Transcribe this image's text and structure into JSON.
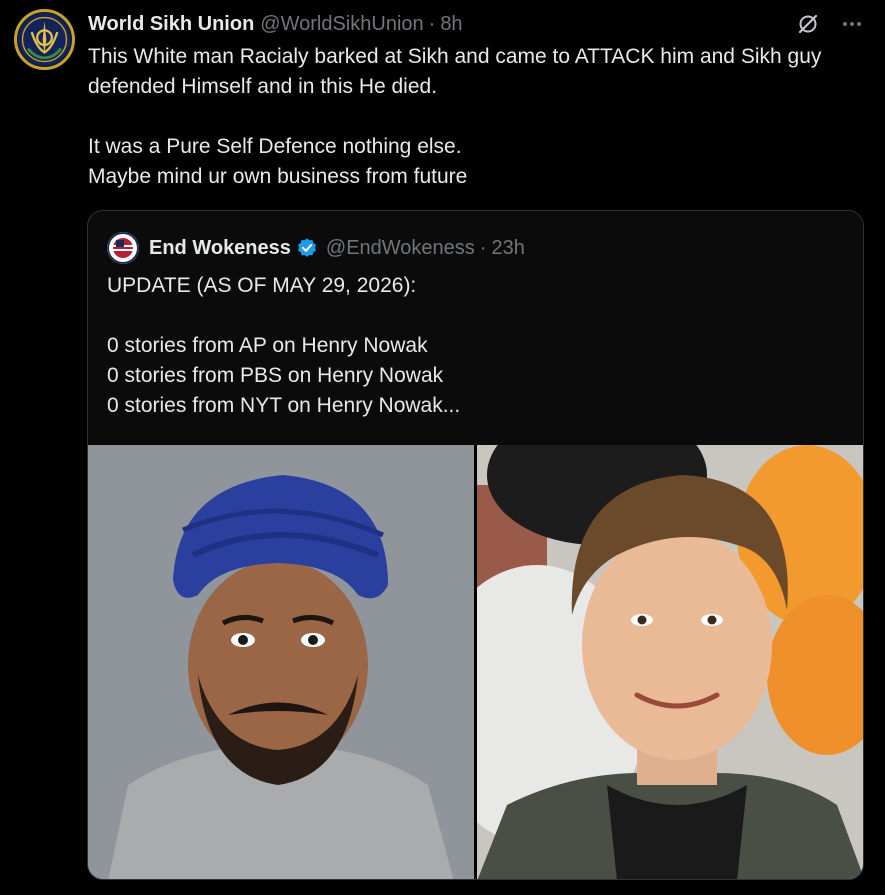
{
  "tweet": {
    "display_name": "World Sikh Union",
    "handle": "@WorldSikhUnion",
    "separator": "·",
    "time": "8h",
    "text": "This White man Racialy barked at Sikh and came to ATTACK him and Sikh guy defended Himself and in this He died.\n\nIt was a Pure Self Defence nothing else.\nMaybe mind ur own business from future",
    "avatar_icon": "khanda-emblem-icon",
    "header_icons": [
      "grok-icon",
      "more-icon"
    ]
  },
  "quote": {
    "display_name": "End Wokeness",
    "verified": true,
    "handle": "@EndWokeness",
    "separator": "·",
    "time": "23h",
    "text": "UPDATE (AS OF MAY 29, 2026):\n\n0 stories from AP on Henry Nowak\n0 stories from PBS on Henry Nowak\n0 stories from NYT on Henry Nowak...",
    "media": [
      {
        "name": "mugshot-photo",
        "description_icon": "photo"
      },
      {
        "name": "portrait-photo",
        "description_icon": "photo"
      }
    ]
  },
  "colors": {
    "background": "#000000",
    "text_primary": "#e7e9ea",
    "text_secondary": "#71767b",
    "border": "#2f3336",
    "verified_blue": "#1d9bf0"
  }
}
